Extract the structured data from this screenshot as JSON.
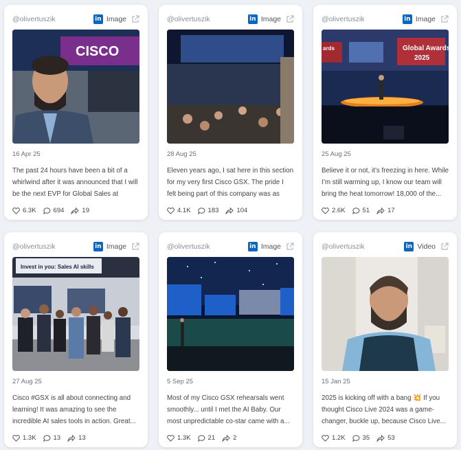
{
  "posts": [
    {
      "handle": "@olivertuszik",
      "media_type": "Image",
      "date": "16 Apr 25",
      "text": "The past 24 hours have been a bit of a whirlwind after it was announced that I will be the next EVP for Global Sales at Cisco....",
      "likes": "6.3K",
      "comments": "694",
      "shares": "19",
      "photo_text": "CISCO"
    },
    {
      "handle": "@olivertuszik",
      "media_type": "Image",
      "date": "28 Aug 25",
      "text": "Eleven years ago, I sat here in this section for my very first Cisco GSX. The pride I felt being part of this company was as stron...",
      "likes": "4.1K",
      "comments": "183",
      "shares": "104"
    },
    {
      "handle": "@olivertuszik",
      "media_type": "Image",
      "date": "25 Aug 25",
      "text": "Believe it or not, it’s freezing in here. While I’m still warming up, I know our team will bring the heat tomorrow! 18,000 of the...",
      "likes": "2.6K",
      "comments": "51",
      "shares": "17",
      "photo_text_1": "Global Awards",
      "photo_text_2": "2025",
      "photo_text_3": "ards"
    },
    {
      "handle": "@olivertuszik",
      "media_type": "Image",
      "date": "27 Aug 25",
      "text": "Cisco #GSX is all about connecting and learning! It was amazing to see the incredible AI sales tools in action. Great...",
      "likes": "1.3K",
      "comments": "13",
      "shares": "13",
      "photo_text": "Invest in you: Sales AI skills"
    },
    {
      "handle": "@olivertuszik",
      "media_type": "Image",
      "date": "5 Sep 25",
      "text": "Most of my Cisco GSX rehearsals went smoothly... until I met the AI Baby. Our most unpredictable co-star came with a...",
      "likes": "1.3K",
      "comments": "21",
      "shares": "2"
    },
    {
      "handle": "@olivertuszik",
      "media_type": "Video",
      "date": "15 Jan 25",
      "text": "2025 is kicking off with a bang 💥 If you thought Cisco Live 2024 was a game-changer, buckle up, because Cisco Live...",
      "likes": "1.2K",
      "comments": "35",
      "shares": "53"
    }
  ],
  "colors": {
    "linkedin": "#0a66c2",
    "card_bg": "#ffffff",
    "page_bg": "#eef1f5"
  }
}
